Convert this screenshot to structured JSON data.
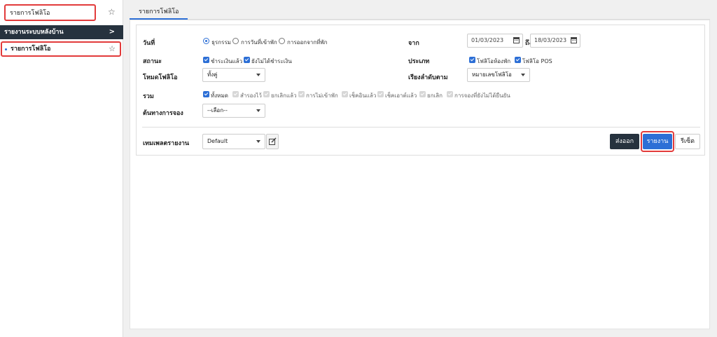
{
  "sidebar": {
    "search_value": "รายการโฟลิโอ",
    "group_label": "รายงานระบบหลังบ้าน",
    "item_label": "รายการโฟลิโอ"
  },
  "tab": {
    "label": "รายการโฟลิโอ"
  },
  "form": {
    "date_label": "วันที่",
    "date_radio_1": "ธุรกรรม",
    "date_radio_2": "การวันที่เข้าพัก",
    "date_radio_3": "การออกจากที่พัก",
    "from_label": "จาก",
    "from_value": "01/03/2023",
    "to_label": "ถึง",
    "to_value": "18/03/2023",
    "status_label": "สถานะ",
    "status_opt_1": "ชำระเงินแล้ว",
    "status_opt_2": "ยังไม่ได้ชำระเงิน",
    "type_label": "ประเภท",
    "type_opt_1": "โฟลิโอห้องพัก",
    "type_opt_2": "โฟลิโอ POS",
    "mode_label": "โหมดโฟลิโอ",
    "mode_value": "ทั้งคู่",
    "sort_label": "เรียงลำดับตาม",
    "sort_value": "หมายเลขโฟลิโอ",
    "include_label": "รวม",
    "include_opts": [
      "ทั้งหมด",
      "สำรองไว้",
      "ยกเลิกแล้ว",
      "การไม่เข้าพัก",
      "เช็คอินแล้ว",
      "เช็คเอาต์แล้ว",
      "ยกเลิก",
      "การจองที่ยังไม่ได้ยืนยัน"
    ],
    "source_label": "ต้นทางการจอง",
    "source_value": "--เลือก--",
    "template_label": "เทมเพลตรายงาน",
    "template_value": "Default"
  },
  "buttons": {
    "export": "ส่งออก",
    "report": "รายงาน",
    "reset": "รีเซ็ต"
  },
  "colors": {
    "accent": "#2d6fd6",
    "dark": "#26323e",
    "highlight": "#e23b3b"
  }
}
